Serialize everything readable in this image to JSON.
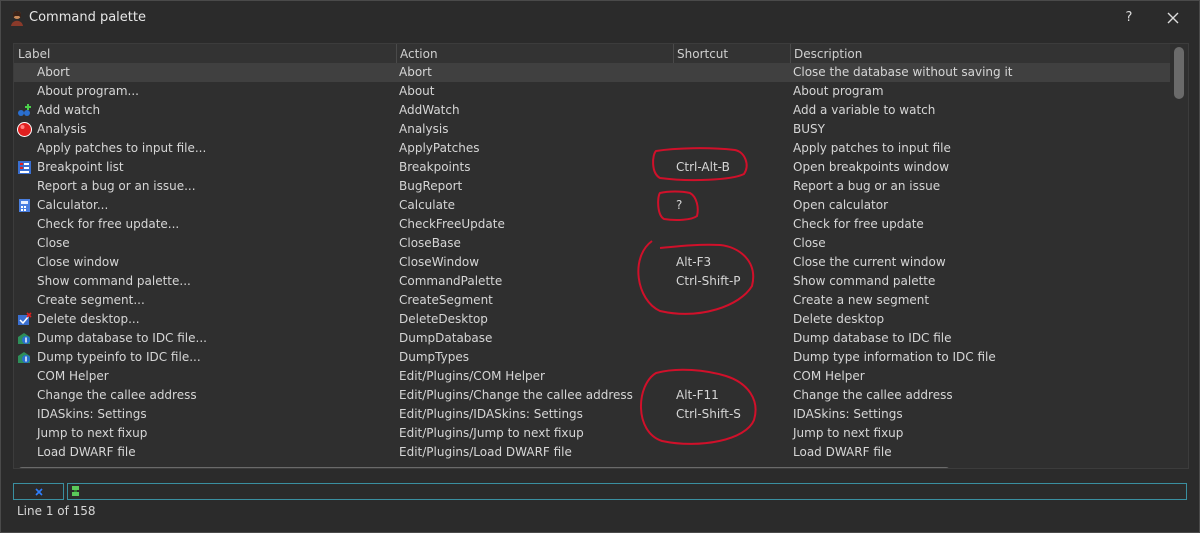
{
  "window": {
    "title": "Command palette",
    "help_label": "?"
  },
  "columns": {
    "label": "Label",
    "action": "Action",
    "shortcut": "Shortcut",
    "description": "Description"
  },
  "rows": [
    {
      "label": "Abort",
      "action": "Abort",
      "shortcut": "",
      "description": "Close the database without saving it",
      "icon": "",
      "selected": true
    },
    {
      "label": "About program...",
      "action": "About",
      "shortcut": "",
      "description": "About program",
      "icon": ""
    },
    {
      "label": "Add watch",
      "action": "AddWatch",
      "shortcut": "",
      "description": "Add a variable to watch",
      "icon": "add-watch-icon"
    },
    {
      "label": "Analysis",
      "action": "Analysis",
      "shortcut": "",
      "description": "BUSY",
      "icon": "red-circle-icon"
    },
    {
      "label": "Apply patches to input file...",
      "action": "ApplyPatches",
      "shortcut": "",
      "description": "Apply patches to input file",
      "icon": ""
    },
    {
      "label": "Breakpoint list",
      "action": "Breakpoints",
      "shortcut": "Ctrl-Alt-B",
      "description": "Open breakpoints window",
      "icon": "breakpoint-list-icon"
    },
    {
      "label": "Report a bug or an issue...",
      "action": "BugReport",
      "shortcut": "",
      "description": "Report a bug or an issue",
      "icon": ""
    },
    {
      "label": "Calculator...",
      "action": "Calculate",
      "shortcut": "?",
      "description": "Open calculator",
      "icon": "calculator-icon"
    },
    {
      "label": "Check for free update...",
      "action": "CheckFreeUpdate",
      "shortcut": "",
      "description": "Check for free update",
      "icon": ""
    },
    {
      "label": "Close",
      "action": "CloseBase",
      "shortcut": "",
      "description": "Close",
      "icon": ""
    },
    {
      "label": "Close window",
      "action": "CloseWindow",
      "shortcut": "Alt-F3",
      "description": "Close the current window",
      "icon": ""
    },
    {
      "label": "Show command palette...",
      "action": "CommandPalette",
      "shortcut": "Ctrl-Shift-P",
      "description": "Show command palette",
      "icon": ""
    },
    {
      "label": "Create segment...",
      "action": "CreateSegment",
      "shortcut": "",
      "description": "Create a new segment",
      "icon": ""
    },
    {
      "label": "Delete desktop...",
      "action": "DeleteDesktop",
      "shortcut": "",
      "description": "Delete desktop",
      "icon": "delete-desktop-icon"
    },
    {
      "label": "Dump database to IDC file...",
      "action": "DumpDatabase",
      "shortcut": "",
      "description": "Dump database to IDC file",
      "icon": "dump-icon"
    },
    {
      "label": "Dump typeinfo to IDC file...",
      "action": "DumpTypes",
      "shortcut": "",
      "description": "Dump type information to IDC file",
      "icon": "dump-icon"
    },
    {
      "label": "COM Helper",
      "action": "Edit/Plugins/COM Helper",
      "shortcut": "",
      "description": "COM Helper",
      "icon": ""
    },
    {
      "label": "Change the callee address",
      "action": "Edit/Plugins/Change the callee address",
      "shortcut": "Alt-F11",
      "description": "Change the callee address",
      "icon": ""
    },
    {
      "label": "IDASkins: Settings",
      "action": "Edit/Plugins/IDASkins: Settings",
      "shortcut": "Ctrl-Shift-S",
      "description": "IDASkins: Settings",
      "icon": ""
    },
    {
      "label": "Jump to next fixup",
      "action": "Edit/Plugins/Jump to next fixup",
      "shortcut": "",
      "description": "Jump to next fixup",
      "icon": ""
    },
    {
      "label": "Load DWARF file",
      "action": "Edit/Plugins/Load DWARF file",
      "shortcut": "",
      "description": "Load DWARF file",
      "icon": ""
    }
  ],
  "status": {
    "text": "Line 1 of 158"
  },
  "colors": {
    "background": "#2b2b2b",
    "selected_row": "#404040",
    "annotation": "#d0102a",
    "filter_border": "#3a8fa0"
  }
}
